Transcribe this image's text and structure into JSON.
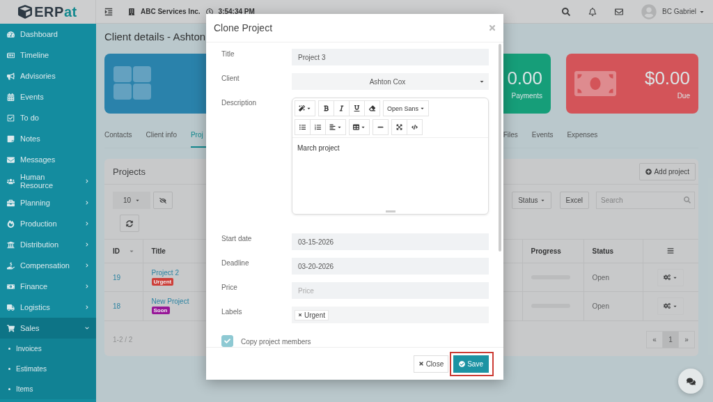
{
  "logo": {
    "dark": "ERP",
    "accent": "at"
  },
  "topbar": {
    "company": "ABC Services Inc.",
    "time": "3:54:34 PM",
    "user": "BC Gabriel"
  },
  "sidebar": {
    "items": [
      {
        "label": "Dashboard",
        "kind": "link",
        "selected": false
      },
      {
        "label": "Timeline",
        "kind": "link",
        "selected": false
      },
      {
        "label": "Advisories",
        "kind": "link",
        "selected": false
      },
      {
        "label": "Events",
        "kind": "link",
        "selected": false
      },
      {
        "label": "To do",
        "kind": "link",
        "selected": false
      },
      {
        "label": "Notes",
        "kind": "link",
        "selected": false
      },
      {
        "label": "Messages",
        "kind": "link",
        "selected": false
      },
      {
        "label": "Human Resource",
        "kind": "menu",
        "expanded": false,
        "selected": false
      },
      {
        "label": "Planning",
        "kind": "menu",
        "expanded": false,
        "selected": false
      },
      {
        "label": "Production",
        "kind": "menu",
        "expanded": false,
        "selected": false
      },
      {
        "label": "Distribution",
        "kind": "menu",
        "expanded": false,
        "selected": false
      },
      {
        "label": "Compensation",
        "kind": "menu",
        "expanded": false,
        "selected": false
      },
      {
        "label": "Finance",
        "kind": "menu",
        "expanded": false,
        "selected": false
      },
      {
        "label": "Logistics",
        "kind": "menu",
        "expanded": false,
        "selected": false
      },
      {
        "label": "Sales",
        "kind": "menu",
        "expanded": true,
        "selected": true,
        "children": [
          {
            "label": "Invoices",
            "selected": false
          },
          {
            "label": "Estimates",
            "selected": false
          },
          {
            "label": "Items",
            "selected": false
          }
        ]
      }
    ]
  },
  "page_title": "Client details - Ashton",
  "stat_cards": [
    {
      "value": "0.00",
      "label": "Payments",
      "color": "#17a67e"
    },
    {
      "value": "$0.00",
      "label": "Due",
      "color": "#e0585c"
    }
  ],
  "tabs": [
    {
      "label": "Contacts",
      "selected": false
    },
    {
      "label": "Client info",
      "selected": false
    },
    {
      "label": "Proj",
      "selected": true
    },
    {
      "label": "Files",
      "selected": false
    },
    {
      "label": "Events",
      "selected": false
    },
    {
      "label": "Expenses",
      "selected": false
    }
  ],
  "projects": {
    "title": "Projects",
    "add_button": "Add project",
    "page_size": "10",
    "status_filter": "Status",
    "excel_button": "Excel",
    "search": {
      "placeholder": "Search"
    },
    "columns": [
      "ID",
      "Title",
      "Progress",
      "Status"
    ],
    "rows": [
      {
        "id": "19",
        "title": "Project 2",
        "label": {
          "text": "Urgent",
          "color": "#d9413a"
        },
        "progress": {
          "level": 0
        },
        "status": "Open"
      },
      {
        "id": "18",
        "title": "New Project",
        "label": {
          "text": "Soon",
          "color": "#a0179f"
        },
        "progress": {
          "level": 0
        },
        "status": "Open"
      }
    ],
    "count": "1-2 / 2",
    "pagination": {
      "prev": "«",
      "pages": [
        {
          "label": "1",
          "selected": true
        }
      ],
      "next": "»"
    }
  },
  "modal": {
    "title": "Clone Project",
    "fields": [
      {
        "kind": "text",
        "label": "Title",
        "value": "Project 3"
      },
      {
        "kind": "select",
        "label": "Client",
        "value": "Ashton Cox"
      },
      {
        "kind": "editor",
        "label": "Description",
        "font": "Open Sans",
        "value": "March project"
      },
      {
        "kind": "text",
        "label": "Start date",
        "value": "03-15-2026"
      },
      {
        "kind": "text",
        "label": "Deadline",
        "value": "03-20-2026"
      },
      {
        "kind": "text",
        "label": "Price",
        "placeholder": "Price"
      },
      {
        "kind": "tags",
        "label": "Labels",
        "tags": [
          "Urgent"
        ]
      }
    ],
    "copy_members": {
      "label": "Copy project members",
      "checked": true
    },
    "close_button": "Close",
    "save_button": "Save"
  }
}
